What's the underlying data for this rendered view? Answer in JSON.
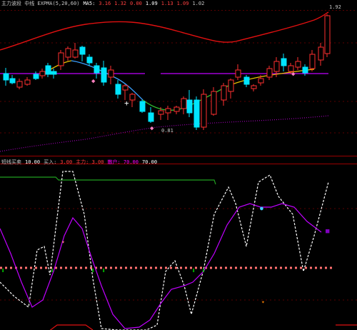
{
  "top_panel": {
    "info_segments": [
      {
        "text": "主力波段 中线 EXPMA(5,20,60)",
        "color": "#c8c8c8"
      },
      {
        "text": "MA5:",
        "color": "#ffffff"
      },
      {
        "text": "3.16",
        "color": "#ff4040"
      },
      {
        "text": "1.32",
        "color": "#ff4040"
      },
      {
        "text": "0.00",
        "color": "#ff4040"
      },
      {
        "text": "1.09",
        "color": "#ffffff"
      },
      {
        "text": "1.13",
        "color": "#ff4040"
      },
      {
        "text": "1.09",
        "color": "#ff4040"
      },
      {
        "text": "1.02",
        "color": "#c8c8c8"
      }
    ],
    "price_labels": [
      {
        "text": "1.92",
        "color": "#c8c8c8"
      },
      {
        "text": "0.81",
        "color": "#c8c8c8"
      }
    ]
  },
  "bottom_panel": {
    "info_segments": [
      {
        "text": "短线买卖",
        "color": "#c8c8c8"
      },
      {
        "text": "10.00",
        "color": "#ffffff"
      },
      {
        "text": "买入:",
        "color": "#c8c8c8"
      },
      {
        "text": "3.00",
        "color": "#ff4040"
      },
      {
        "text": "主力: 3.00",
        "color": "#ff4040"
      },
      {
        "text": "散户: 70.00",
        "color": "#ff00ff"
      },
      {
        "text": "70.00",
        "color": "#ffffff"
      }
    ]
  },
  "colors": {
    "background": "#000000",
    "up_candle": "#ff3030",
    "down_candle": "#00e5ff",
    "long_ma": "#e01010",
    "level_line": "#c000ff",
    "dotted_ma": "#9a00b0",
    "separator": "#9a0000",
    "green_line": "#20a020",
    "buy_marker": "#00d000",
    "dashed_level": "#ff7070"
  },
  "icons": [
    "buy-arrow-icon",
    "sell-marker-icon",
    "cursor-crosshair-icon"
  ]
}
